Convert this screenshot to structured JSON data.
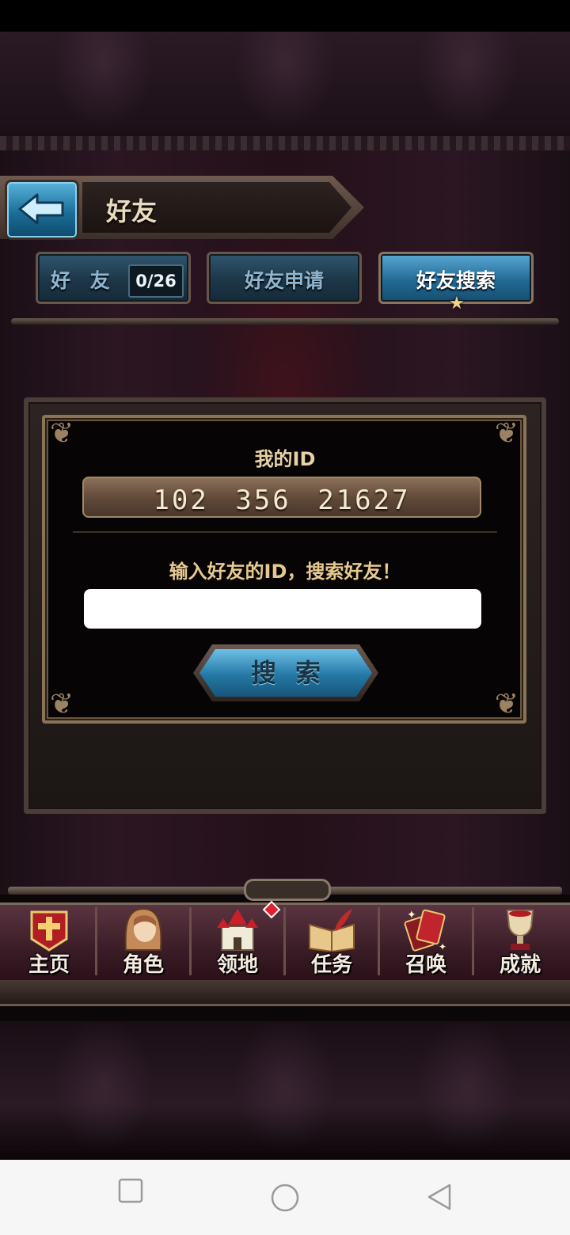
{
  "header": {
    "title": "好友"
  },
  "tabs": [
    {
      "label": "好 友",
      "count": "0/26"
    },
    {
      "label": "好友申请"
    },
    {
      "label": "好友搜索"
    }
  ],
  "panel": {
    "my_id_label": "我的ID",
    "my_id_value": "102 356 21627",
    "prompt": "输入好友的ID，搜索好友！",
    "input_value": "",
    "search_button": "搜索"
  },
  "bottom_nav": [
    {
      "label": "主页",
      "icon": "home-banner-icon"
    },
    {
      "label": "角色",
      "icon": "character-hood-icon"
    },
    {
      "label": "领地",
      "icon": "castle-icon"
    },
    {
      "label": "任务",
      "icon": "quest-book-icon"
    },
    {
      "label": "召唤",
      "icon": "summon-cards-icon"
    },
    {
      "label": "成就",
      "icon": "trophy-icon"
    }
  ],
  "colors": {
    "accent_blue": "#2478a4",
    "gold_text": "#e6c98e",
    "notification": "#e02030"
  }
}
